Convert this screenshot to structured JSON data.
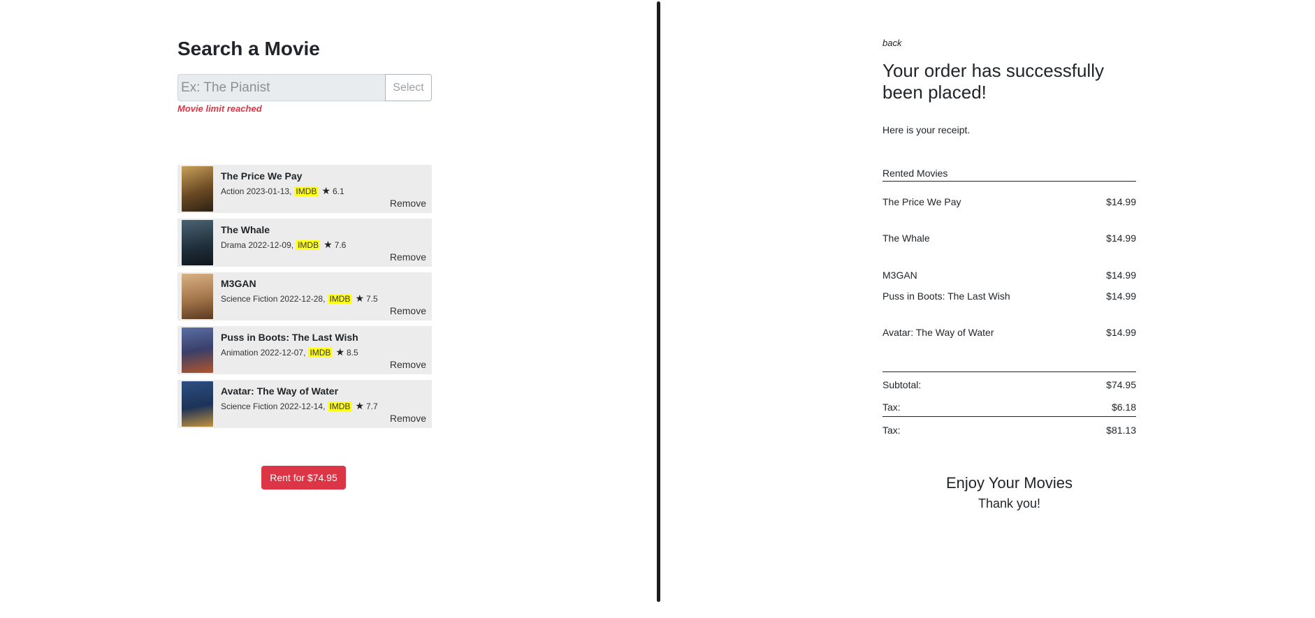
{
  "search": {
    "title": "Search a Movie",
    "placeholder": "Ex: The Pianist",
    "value": "",
    "select_label": "Select",
    "limit_message": "Movie limit reached"
  },
  "movies": [
    {
      "title": "The Price We Pay",
      "genre": "Action",
      "date": "2023-01-13,",
      "imdb": "IMDB",
      "rating": "6.1",
      "remove": "Remove",
      "poster_color": "#8a6a3a"
    },
    {
      "title": "The Whale",
      "genre": "Drama",
      "date": "2022-12-09,",
      "imdb": "IMDB",
      "rating": "7.6",
      "remove": "Remove",
      "poster_color": "#2a3e4c"
    },
    {
      "title": "M3GAN",
      "genre": "Science Fiction",
      "date": "2022-12-28,",
      "imdb": "IMDB",
      "rating": "7.5",
      "remove": "Remove",
      "poster_color": "#b5895a"
    },
    {
      "title": "Puss in Boots: The Last Wish",
      "genre": "Animation",
      "date": "2022-12-07,",
      "imdb": "IMDB",
      "rating": "8.5",
      "remove": "Remove",
      "poster_color": "#3c4a72"
    },
    {
      "title": "Avatar: The Way of Water",
      "genre": "Science Fiction",
      "date": "2022-12-14,",
      "imdb": "IMDB",
      "rating": "7.7",
      "remove": "Remove",
      "poster_color": "#1f3d66"
    }
  ],
  "rent_button_label": "Rent for $74.95",
  "receipt": {
    "back_label": "back",
    "title": "Your order has successfully been placed!",
    "intro": "Here is your receipt.",
    "rented_header": "Rented Movies",
    "items": [
      {
        "name": "The Price We Pay",
        "price": "$14.99"
      },
      {
        "name": "The Whale",
        "price": "$14.99"
      },
      {
        "name": "M3GAN",
        "price": "$14.99"
      },
      {
        "name": "Puss in Boots: The Last Wish",
        "price": "$14.99"
      },
      {
        "name": "Avatar: The Way of Water",
        "price": "$14.99"
      }
    ],
    "subtotal_label": "Subtotal:",
    "subtotal_value": "$74.95",
    "tax_label": "Tax:",
    "tax_value": "$6.18",
    "total_label": "Tax:",
    "total_value": "$81.13",
    "enjoy": "Enjoy Your Movies",
    "thanks": "Thank you!"
  },
  "colors": {
    "accent": "#dc3545",
    "imdb_highlight": "#ffff1a",
    "card_bg": "#ececec",
    "divider": "#1c1c1c"
  },
  "icons": {
    "star": "star-icon"
  }
}
